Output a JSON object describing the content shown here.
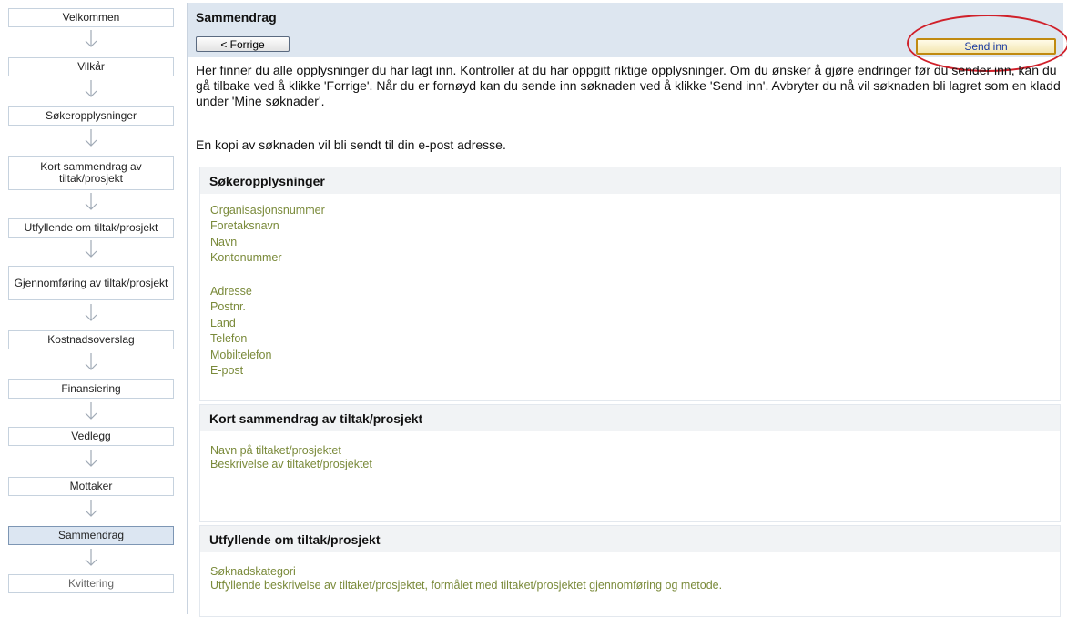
{
  "sidebar": {
    "steps": [
      {
        "label": "Velkommen"
      },
      {
        "label": "Vilkår"
      },
      {
        "label": "Søkeropplysninger"
      },
      {
        "label": "Kort sammendrag av tiltak/prosjekt"
      },
      {
        "label": "Utfyllende om tiltak/prosjekt"
      },
      {
        "label": "Gjennomføring av tiltak/prosjekt"
      },
      {
        "label": "Kostnadsoverslag"
      },
      {
        "label": "Finansiering"
      },
      {
        "label": "Vedlegg"
      },
      {
        "label": "Mottaker"
      },
      {
        "label": "Sammendrag"
      },
      {
        "label": "Kvittering"
      }
    ],
    "active_step": "Sammendrag",
    "arrow_icon": "arrow-down-icon"
  },
  "main": {
    "title": "Sammendrag",
    "prev_button": "< Forrige",
    "send_button": "Send inn",
    "intro": "Her finner du alle opplysninger du har lagt inn. Kontroller at du har oppgitt riktige opplysninger. Om du ønsker å gjøre endringer før du sender inn, kan du gå tilbake ved å klikke 'Forrige'. Når du er fornøyd kan du sende inn søknaden ved å klikke 'Send inn'. Avbryter du nå vil søknaden bli lagret som en kladd under 'Mine søknader'.",
    "copy_note": "En kopi av søknaden vil bli sendt til din e-post adresse."
  },
  "sections": {
    "applicant": {
      "title": "Søkeropplysninger",
      "fields": [
        "Organisasjonsnummer",
        "Foretaksnavn",
        "Navn",
        "Kontonummer",
        "Adresse",
        "Postnr.",
        "Land",
        "Telefon",
        "Mobiltelefon",
        "E-post"
      ]
    },
    "summary": {
      "title": "Kort sammendrag av tiltak/prosjekt",
      "fields": [
        "Navn på tiltaket/prosjektet",
        "Beskrivelse av tiltaket/prosjektet"
      ]
    },
    "details": {
      "title": "Utfyllende om tiltak/prosjekt",
      "fields": [
        "Søknadskategori",
        "Utfyllende beskrivelse av tiltaket/prosjektet, formålet med tiltaket/prosjektet gjennomføring og metode."
      ]
    }
  },
  "colors": {
    "header_bg": "#dde6f0",
    "field_label": "#7a8a3a",
    "highlight_ring": "#d0202a",
    "active_step_bg": "#dce6f2"
  }
}
